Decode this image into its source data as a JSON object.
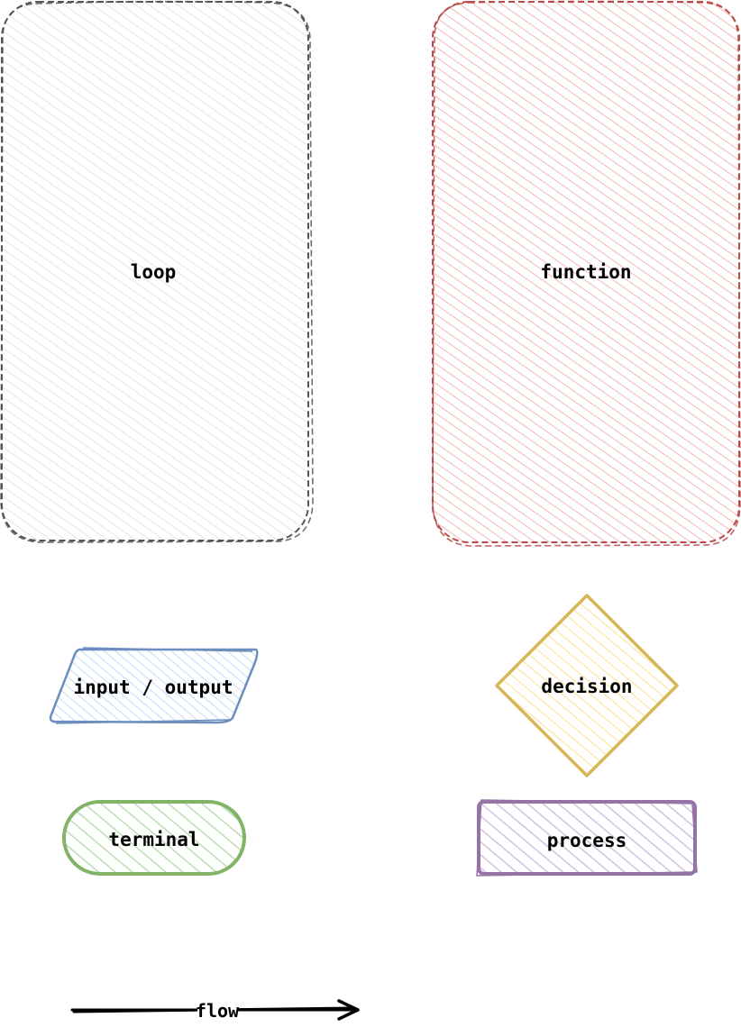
{
  "diagram": {
    "type": "flowchart legend",
    "shapes": [
      {
        "id": "loop",
        "kind": "rounded-rect-dashed",
        "label": "loop",
        "stroke": "#555555",
        "fill": "#f0f0f0"
      },
      {
        "id": "function",
        "kind": "rounded-rect-dashed",
        "label": "function",
        "stroke": "#b94a48",
        "fill": "#f8cecc"
      },
      {
        "id": "io",
        "kind": "parallelogram",
        "label": "input / output",
        "stroke": "#6c8ebf",
        "fill": "#dae8fc"
      },
      {
        "id": "decision",
        "kind": "diamond",
        "label": "decision",
        "stroke": "#d6b656",
        "fill": "#fff2cc"
      },
      {
        "id": "terminal",
        "kind": "stadium",
        "label": "terminal",
        "stroke": "#82b366",
        "fill": "#d5e8d4"
      },
      {
        "id": "process",
        "kind": "rect",
        "label": "process",
        "stroke": "#9673a6",
        "fill": "#e1d5e7"
      }
    ],
    "edges": [
      {
        "id": "flow",
        "label": "flow",
        "stroke": "#000000",
        "arrow": "open"
      }
    ]
  }
}
